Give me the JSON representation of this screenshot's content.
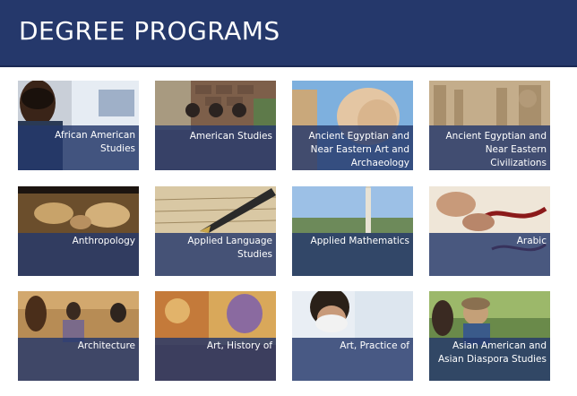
{
  "header": {
    "title": "DEGREE PROGRAMS"
  },
  "programs": [
    {
      "label": "African American Studies"
    },
    {
      "label": "American Studies"
    },
    {
      "label": "Ancient Egyptian and Near Eastern Art and Archaeology"
    },
    {
      "label": "Ancient Egyptian and Near Eastern Civilizations"
    },
    {
      "label": "Anthropology"
    },
    {
      "label": "Applied Language Studies"
    },
    {
      "label": "Applied Mathematics"
    },
    {
      "label": "Arabic"
    },
    {
      "label": "Architecture"
    },
    {
      "label": "Art, History of"
    },
    {
      "label": "Art, Practice of"
    },
    {
      "label": "Asian American and Asian Diaspora Studies"
    }
  ],
  "colors": {
    "header": "#25386b",
    "band": "#25386b",
    "text": "#ffffff"
  }
}
